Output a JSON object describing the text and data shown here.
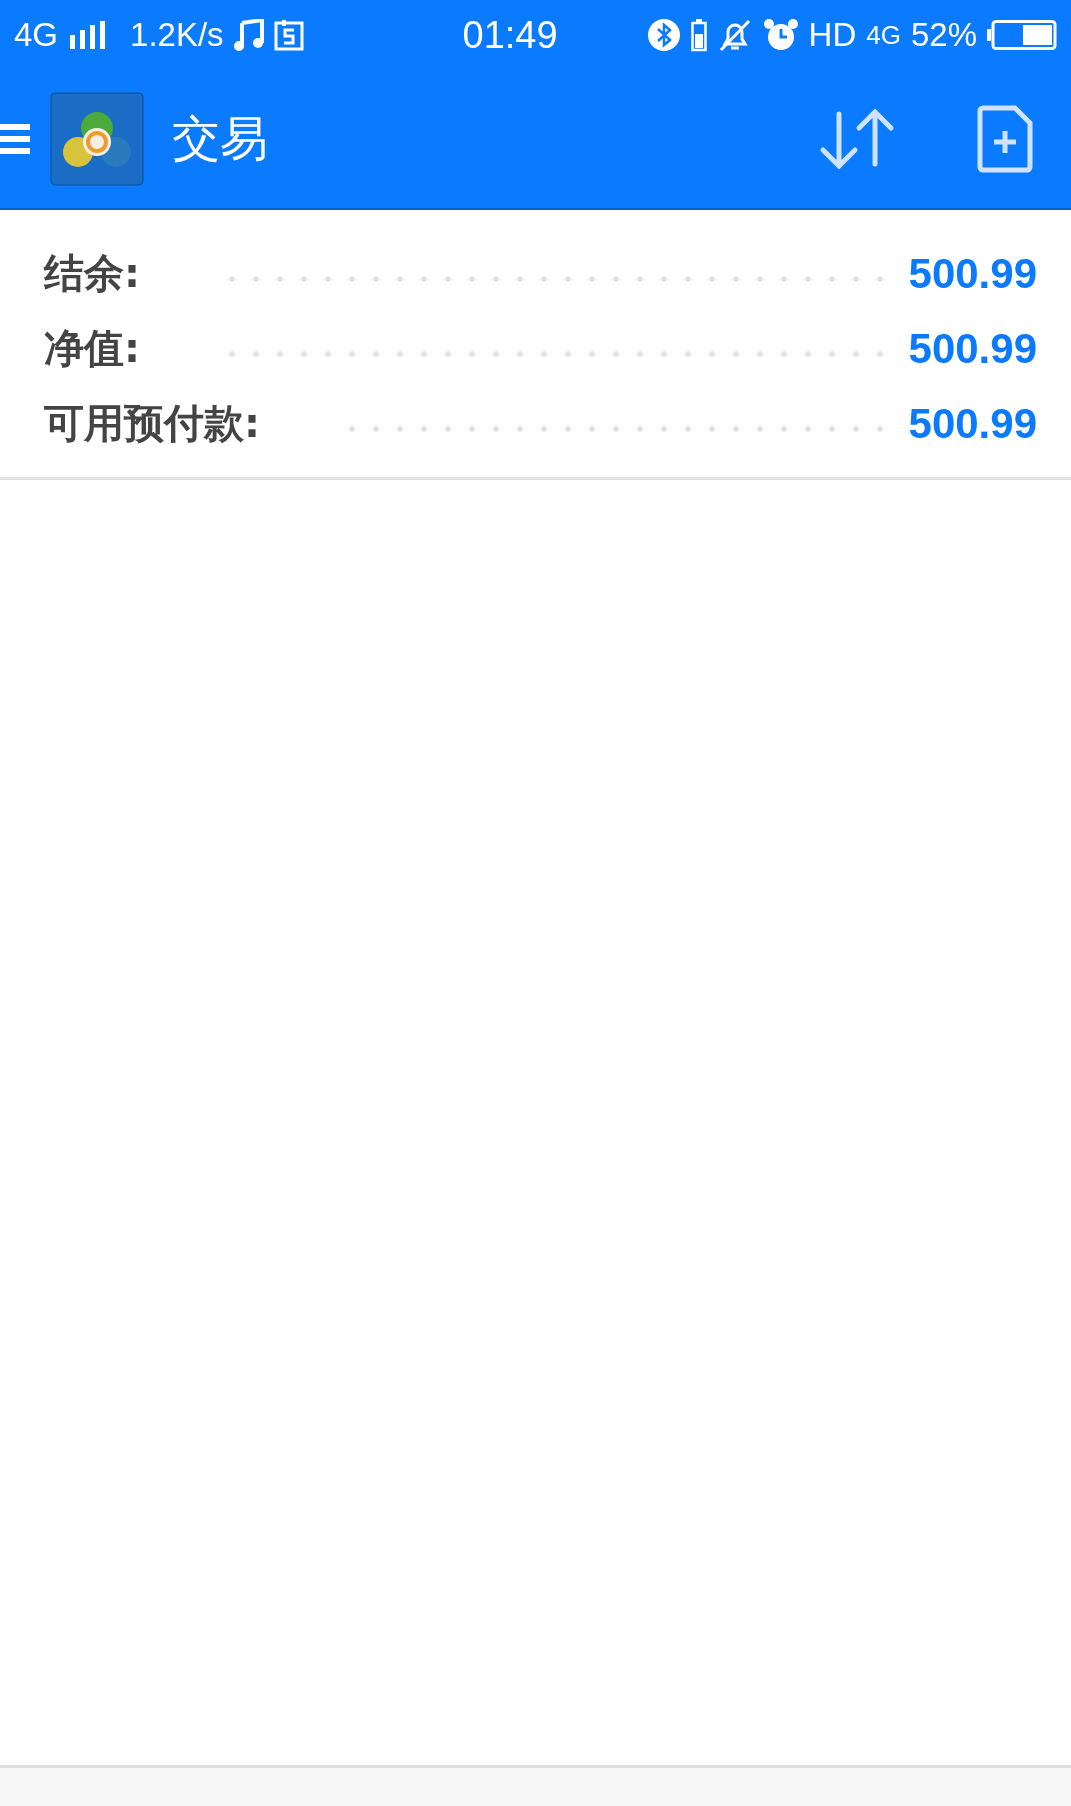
{
  "status_bar": {
    "network": "4G",
    "speed": "1.2K/s",
    "time": "01:49",
    "hd": "HD",
    "network_2": "4G",
    "battery": "52%"
  },
  "header": {
    "title": "交易"
  },
  "account": [
    {
      "label": "结余:",
      "value": "500.99"
    },
    {
      "label": "净值:",
      "value": "500.99"
    },
    {
      "label": "可用预付款:",
      "value": "500.99"
    }
  ]
}
